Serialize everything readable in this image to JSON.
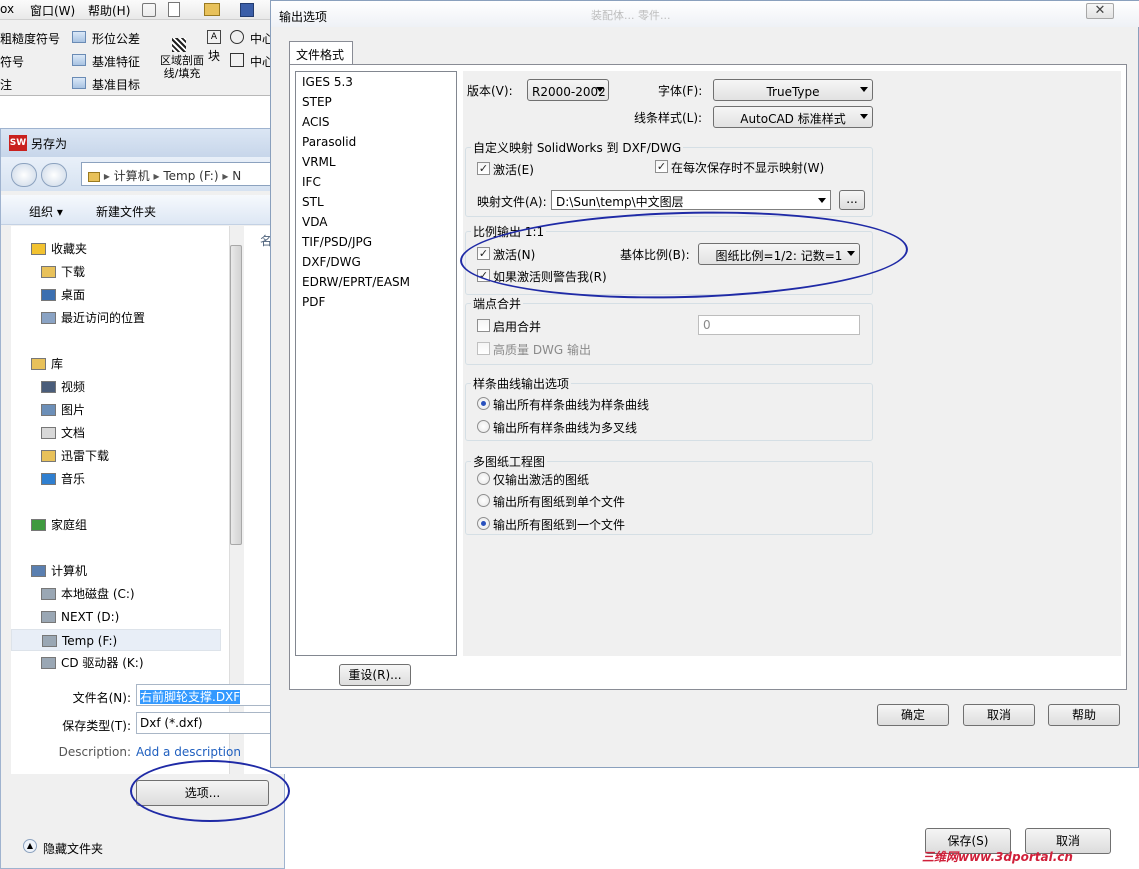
{
  "app": {
    "menu": [
      "ox",
      "窗口(W)",
      "帮助(H)"
    ],
    "toolbar": {
      "row1": [
        "粗糙度符号",
        "形位公差",
        "中心"
      ],
      "row2": [
        "符号",
        "基准特征",
        "中心"
      ],
      "row3": [
        "注",
        "基准目标"
      ],
      "hatch_label": "区域剖面线/填充",
      "block_label": "块"
    },
    "title_fragment": "装配体... 零件..."
  },
  "save_dialog": {
    "title": "另存为",
    "logo": "SW",
    "address": [
      "计算机",
      "Temp (F:)",
      "N"
    ],
    "commands": {
      "organize": "组织",
      "new_folder": "新建文件夹"
    },
    "list_header": "名",
    "nav": [
      {
        "label": "收藏夹",
        "head": true
      },
      {
        "label": "下载"
      },
      {
        "label": "桌面"
      },
      {
        "label": "最近访问的位置"
      },
      {
        "label": "库",
        "head": true
      },
      {
        "label": "视频"
      },
      {
        "label": "图片"
      },
      {
        "label": "文档"
      },
      {
        "label": "迅雷下载"
      },
      {
        "label": "音乐"
      },
      {
        "label": "家庭组",
        "head": true
      },
      {
        "label": "计算机",
        "head": true
      },
      {
        "label": "本地磁盘 (C:)"
      },
      {
        "label": "NEXT (D:)"
      },
      {
        "label": "Temp (F:)",
        "selected": true
      },
      {
        "label": "CD 驱动器 (K:)"
      }
    ],
    "filename_label": "文件名(N):",
    "filename_value": "右前脚轮支撑.DXF",
    "filetype_label": "保存类型(T):",
    "filetype_value": "Dxf (*.dxf)",
    "description_label": "Description:",
    "description_link": "Add a description",
    "options_button": "选项...",
    "hide_folders": "隐藏文件夹",
    "save_button": "保存(S)",
    "cancel_button": "取消"
  },
  "options_dialog": {
    "title": "输出选项",
    "close_glyph": "✕",
    "tab": "文件格式",
    "formats": [
      "IGES 5.3",
      "STEP",
      "ACIS",
      "Parasolid",
      "VRML",
      "IFC",
      "STL",
      "VDA",
      "TIF/PSD/JPG",
      "DXF/DWG",
      "EDRW/EPRT/EASM",
      "PDF"
    ],
    "version_label": "版本(V):",
    "version_value": "R2000-2002",
    "font_label": "字体(F):",
    "font_value": "TrueType",
    "linestyle_label": "线条样式(L):",
    "linestyle_value": "AutoCAD 标准样式",
    "mapping_group": "自定义映射 SolidWorks 到 DXF/DWG",
    "mapping_activate": "激活(E)",
    "mapping_noshow": "在每次保存时不显示映射(W)",
    "mapping_file_label": "映射文件(A):",
    "mapping_file_value": "D:\\Sun\\temp\\中文图层",
    "browse_button": "...",
    "scale_group": "比例输出 1:1",
    "scale_activate": "激活(N)",
    "scale_warn": "如果激活则警告我(R)",
    "base_scale_label": "基体比例(B):",
    "base_scale_value": "图纸比例=1/2: 记数=1",
    "merge_group": "端点合并",
    "merge_enable": "启用合并",
    "merge_value": "0",
    "hq_dwg": "高质量 DWG 输出",
    "spline_group": "样条曲线输出选项",
    "spline_opt1": "输出所有样条曲线为样条曲线",
    "spline_opt2": "输出所有样条曲线为多叉线",
    "multisheet_group": "多图纸工程图",
    "sheet_opt1": "仅输出激活的图纸",
    "sheet_opt2": "输出所有图纸到单个文件",
    "sheet_opt3": "输出所有图纸到一个文件",
    "reset_button": "重设(R)...",
    "ok_button": "确定",
    "cancel_button": "取消",
    "help_button": "帮助"
  },
  "watermark": "三维网www.3dportal.cn",
  "colors": {
    "annotation": "#1f2aa6",
    "selection": "#3399ff",
    "link": "#1f5fbf"
  }
}
